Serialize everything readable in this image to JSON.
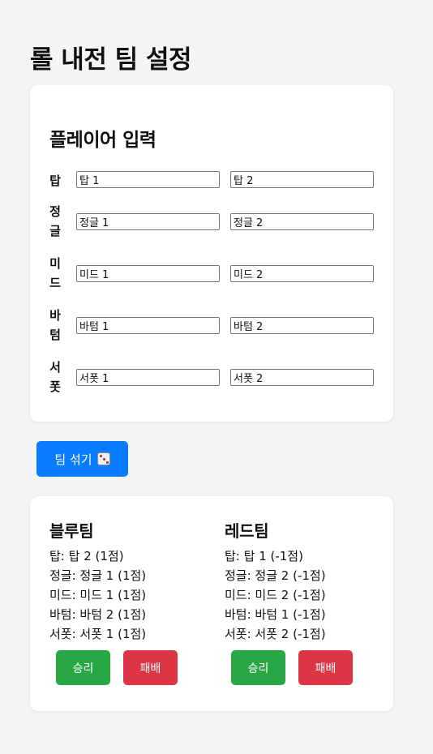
{
  "page": {
    "title": "롤 내전 팀 설정"
  },
  "player_input": {
    "title": "플레이어 입력",
    "roles": [
      {
        "label": "탑",
        "player1": "탑 1",
        "player2": "탑 2"
      },
      {
        "label": "정글",
        "player1": "정글 1",
        "player2": "정글 2"
      },
      {
        "label": "미드",
        "player1": "미드 1",
        "player2": "미드 2"
      },
      {
        "label": "바텀",
        "player1": "바텀 1",
        "player2": "바텀 2"
      },
      {
        "label": "서폿",
        "player1": "서폿 1",
        "player2": "서폿 2"
      }
    ]
  },
  "shuffle_button": {
    "label": "팀 섞기",
    "icon": "dice-icon"
  },
  "teams": {
    "blue": {
      "title": "블루팀",
      "lines": [
        "탑: 탑 2 (1점)",
        "정글: 정글 1 (1점)",
        "미드: 미드 1 (1점)",
        "바텀: 바텀 2 (1점)",
        "서폿: 서폿 1 (1점)"
      ],
      "win_label": "승리",
      "lose_label": "패배"
    },
    "red": {
      "title": "레드팀",
      "lines": [
        "탑: 탑 1 (-1점)",
        "정글: 정글 2 (-1점)",
        "미드: 미드 2 (-1점)",
        "바텀: 바텀 1 (-1점)",
        "서폿: 서폿 2 (-1점)"
      ],
      "win_label": "승리",
      "lose_label": "패배"
    }
  },
  "colors": {
    "primary": "#0a7cff",
    "win": "#28a745",
    "lose": "#dc3545",
    "background": "#f4f5f7"
  }
}
